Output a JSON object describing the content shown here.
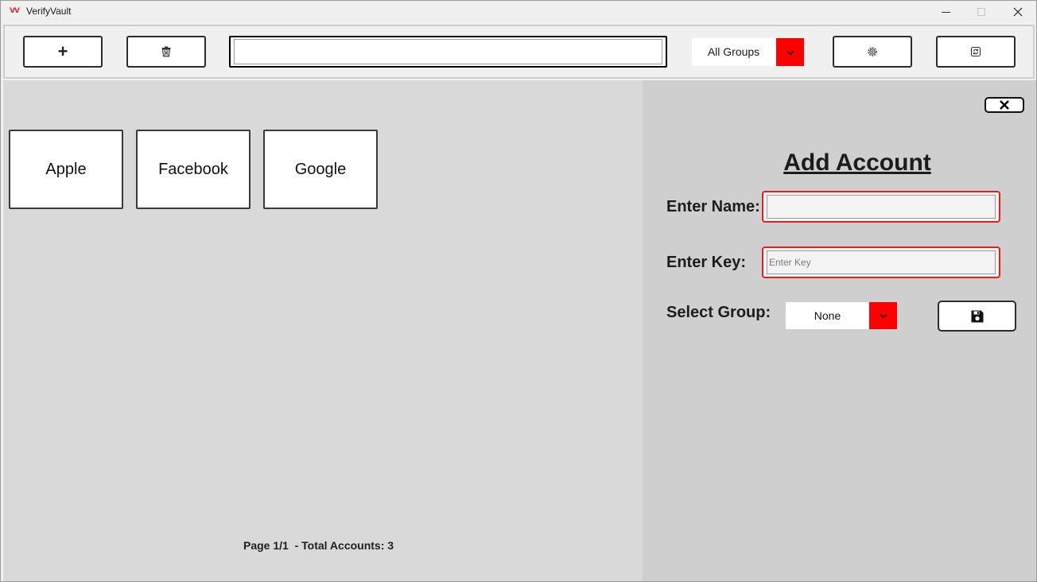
{
  "window": {
    "logo_text": "VV",
    "title": "VerifyVault"
  },
  "toolbar": {
    "add_label": "+",
    "search_value": "",
    "group_filter": "All Groups",
    "icons": [
      "plus-icon",
      "trash-icon",
      "chevron-down-icon",
      "gear-icon",
      "refresh-icon"
    ]
  },
  "accounts": [
    {
      "name": "Apple"
    },
    {
      "name": "Facebook"
    },
    {
      "name": "Google"
    }
  ],
  "pager": {
    "text": "Page 1/1  - Total Accounts: 3"
  },
  "panel": {
    "title": "Add Account",
    "name_label": "Enter Name:",
    "name_value": "",
    "key_label": "Enter Key:",
    "key_placeholder": "Enter Key",
    "group_label": "Select Group:",
    "group_value": "None"
  },
  "colors": {
    "accent": "#ff0000",
    "field_border": "#e02020",
    "main_bg": "#d9d9d9",
    "panel_bg": "#cfcfcf"
  }
}
